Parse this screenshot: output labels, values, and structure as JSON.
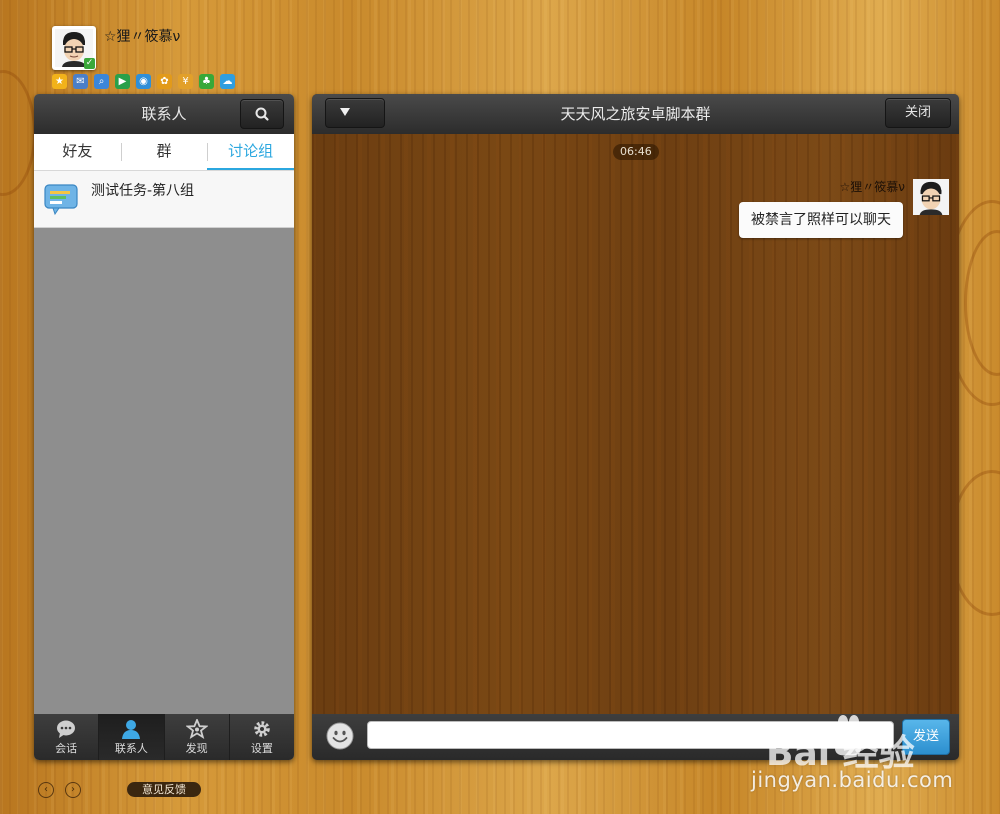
{
  "profile": {
    "nickname": "☆狸〃筱慕ν",
    "app_icons": [
      {
        "name": "qzone-icon",
        "glyph": "★",
        "color": "#f2b21a"
      },
      {
        "name": "mail-icon",
        "glyph": "✉",
        "color": "#4b7fc8"
      },
      {
        "name": "search-icon",
        "glyph": "⌕",
        "color": "#3c86d8"
      },
      {
        "name": "app-store-icon",
        "glyph": "▶",
        "color": "#2aa04a"
      },
      {
        "name": "browser-icon",
        "glyph": "◉",
        "color": "#2f8fd8"
      },
      {
        "name": "game-icon",
        "glyph": "✿",
        "color": "#e29a1a"
      },
      {
        "name": "wallet-icon",
        "glyph": "¥",
        "color": "#e2a02a"
      },
      {
        "name": "clover-icon",
        "glyph": "♣",
        "color": "#38a838"
      },
      {
        "name": "weiyun-icon",
        "glyph": "☁",
        "color": "#2f9ee0"
      }
    ]
  },
  "contacts": {
    "title": "联系人",
    "tabs": [
      {
        "label": "好友",
        "active": false
      },
      {
        "label": "群",
        "active": false
      },
      {
        "label": "讨论组",
        "active": true
      }
    ],
    "groups": [
      {
        "name": "测试任务-第八组"
      }
    ]
  },
  "nav": {
    "items": [
      {
        "label": "会话",
        "icon": "chat-icon",
        "active": false
      },
      {
        "label": "联系人",
        "icon": "contacts-icon",
        "active": true
      },
      {
        "label": "发现",
        "icon": "discover-icon",
        "active": false
      },
      {
        "label": "设置",
        "icon": "settings-icon",
        "active": false
      }
    ]
  },
  "chat": {
    "title": "天天风之旅安卓脚本群",
    "close_label": "关闭",
    "time": "06:46",
    "sender": "☆狸〃筱慕ν",
    "message": "被禁言了照样可以聊天",
    "input_value": "",
    "send_label": "发送"
  },
  "footer": {
    "feedback_label": "意见反馈"
  },
  "watermark": {
    "brand": "Bai  经验",
    "url": "jingyan.baidu.com"
  },
  "colors": {
    "accent": "#2ba7df",
    "header_dark": "#2c2c2c",
    "send_button": "#3a9fdc"
  }
}
